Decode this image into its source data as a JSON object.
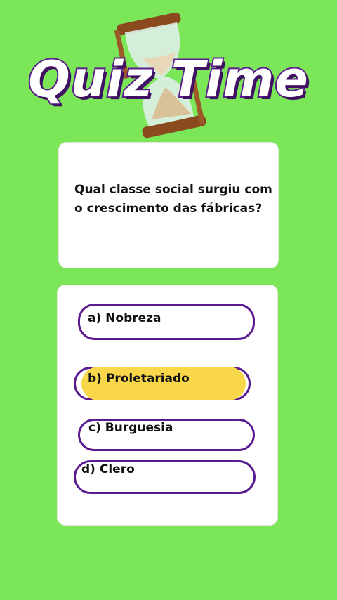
{
  "header": {
    "title": "Quiz Time"
  },
  "question": {
    "text": "Qual classe social surgiu com o crescimento das fábricas?"
  },
  "options": [
    {
      "label": "a) Nobreza"
    },
    {
      "label": "b) Proletariado",
      "highlighted": true
    },
    {
      "label": "c) Burguesia"
    },
    {
      "label": "d) Clero"
    }
  ],
  "colors": {
    "background": "#7be657",
    "accent_purple": "#5c1a8f",
    "highlight_yellow": "#f9d74a"
  },
  "icons": {
    "decoration": "hourglass-icon"
  }
}
